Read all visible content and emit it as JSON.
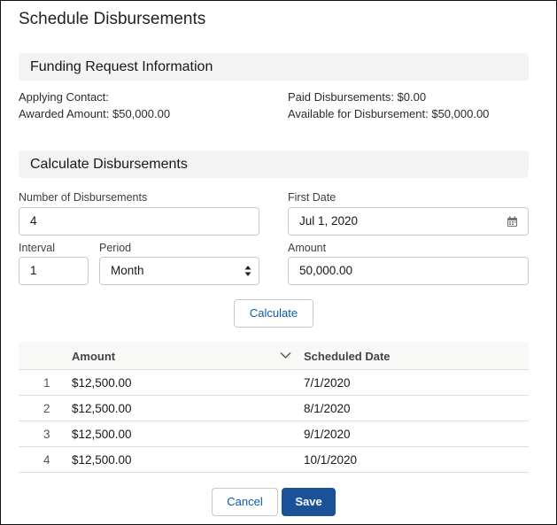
{
  "title": "Schedule Disbursements",
  "funding": {
    "heading": "Funding Request Information",
    "applying_contact": "Applying Contact:",
    "awarded_amount": "Awarded Amount: $50,000.00",
    "paid": "Paid Disbursements: $0.00",
    "available": "Available for Disbursement: $50,000.00"
  },
  "calc": {
    "heading": "Calculate Disbursements",
    "num_label": "Number of Disbursements",
    "num_value": "4",
    "first_date_label": "First Date",
    "first_date_value": "Jul 1, 2020",
    "interval_label": "Interval",
    "interval_value": "1",
    "period_label": "Period",
    "period_value": "Month",
    "amount_label": "Amount",
    "amount_value": "50,000.00",
    "calculate": "Calculate"
  },
  "table": {
    "headers": {
      "amount": "Amount",
      "date": "Scheduled Date"
    },
    "rows": [
      {
        "n": "1",
        "amount": "$12,500.00",
        "date": "7/1/2020"
      },
      {
        "n": "2",
        "amount": "$12,500.00",
        "date": "8/1/2020"
      },
      {
        "n": "3",
        "amount": "$12,500.00",
        "date": "9/1/2020"
      },
      {
        "n": "4",
        "amount": "$12,500.00",
        "date": "10/1/2020"
      }
    ]
  },
  "footer": {
    "cancel": "Cancel",
    "save": "Save"
  }
}
